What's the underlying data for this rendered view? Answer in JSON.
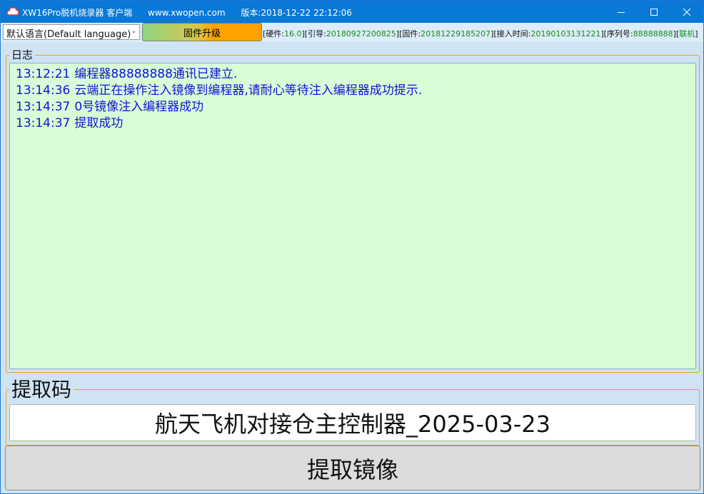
{
  "window": {
    "app_name": "XW16Pro脱机烧录器 客户端",
    "website": "www.xwopen.com",
    "version": "版本:2018-12-22 22:12:06"
  },
  "toolbar": {
    "language": "默认语言(Default language)",
    "firmware_upgrade": "固件升级",
    "status": [
      {
        "label": "[硬件:",
        "value": "16.0",
        "end": "]"
      },
      {
        "label": "[引导:",
        "value": "20180927200825",
        "end": "]"
      },
      {
        "label": "[固件:",
        "value": "20181229185207",
        "end": "]"
      },
      {
        "label": "[接入时间:",
        "value": "20190103131221",
        "end": "]"
      },
      {
        "label": "[序列号:",
        "value": "88888888",
        "end": "]"
      },
      {
        "label": "[",
        "value": "联机",
        "end": "]"
      }
    ]
  },
  "log": {
    "title": "日志",
    "entries": [
      {
        "time": "13:12:21",
        "message": "编程器88888888通讯已建立."
      },
      {
        "time": "13:14:36",
        "message": "云端正在操作注入镜像到编程器,请耐心等待注入编程器成功提示."
      },
      {
        "time": "13:14:37",
        "message": "0号镜像注入编程器成功"
      },
      {
        "time": "13:14:37",
        "message": "提取成功"
      }
    ]
  },
  "extraction": {
    "title": "提取码",
    "code_value": "航天飞机对接仓主控制器_2025-03-23",
    "button_label": "提取镜像"
  },
  "colors": {
    "titlebar": "#0a78d7",
    "log_background": "#d9fdd6",
    "log_text": "#1212d8",
    "status_value": "#1a8a1a",
    "group_border": "#e6a817"
  }
}
